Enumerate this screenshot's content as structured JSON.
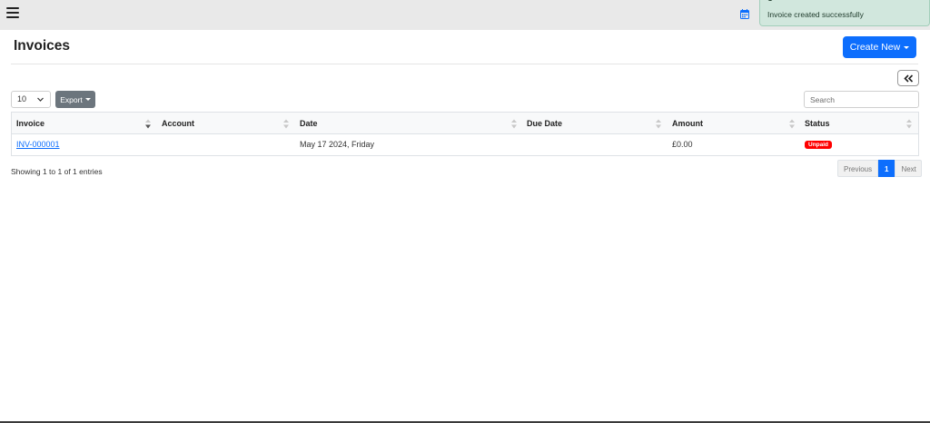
{
  "toast": {
    "message": "Invoice created successfully"
  },
  "page": {
    "title": "Invoices",
    "create_label": "Create New"
  },
  "controls": {
    "page_length": "10",
    "export_label": "Export",
    "search_placeholder": "Search"
  },
  "table": {
    "columns": [
      "Invoice",
      "Account",
      "Date",
      "Due Date",
      "Amount",
      "Status"
    ],
    "rows": [
      {
        "invoice": "INV-000001",
        "account": "",
        "date": "May 17 2024, Friday",
        "due_date": "",
        "amount": "£0.00",
        "status": "Unpaid"
      }
    ]
  },
  "footer": {
    "info": "Showing 1 to 1 of 1 entries"
  },
  "pagination": {
    "previous": "Previous",
    "current": "1",
    "next": "Next"
  },
  "colors": {
    "primary": "#0d6efd",
    "unpaid": "#ff0000",
    "toast_bg": "#d1e7dd"
  },
  "icons": [
    "menu-icon",
    "calendar-icon",
    "double-chevron-left-icon",
    "chevron-down-icon",
    "sort-icon",
    "sort-desc-icon"
  ]
}
